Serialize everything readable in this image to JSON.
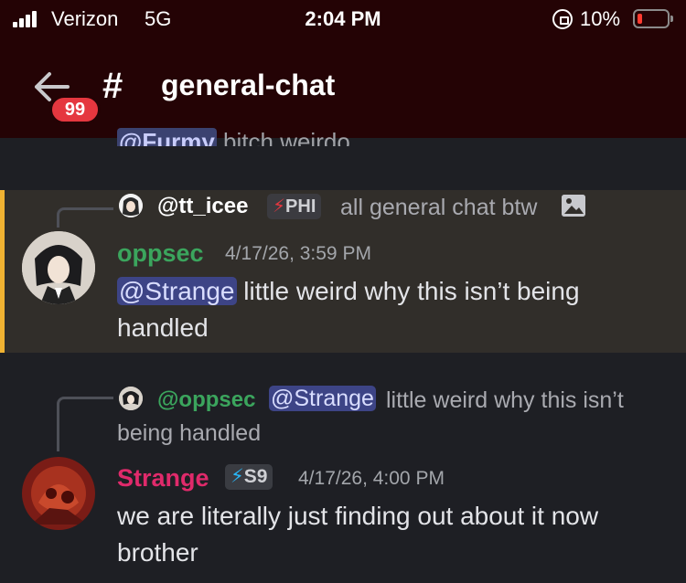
{
  "status_bar": {
    "carrier": "Verizon",
    "network": "5G",
    "time": "2:04 PM",
    "battery": "10%"
  },
  "header": {
    "badge_count": "99",
    "hash": "#",
    "channel": "general-chat"
  },
  "partial_message": {
    "mention": "@Furmy",
    "text": "bitch weirdo"
  },
  "message1": {
    "reply": {
      "name": "@tt_icee",
      "tag": "PHI",
      "text": "all general chat btw"
    },
    "author": "oppsec",
    "time": "4/17/26, 3:59 PM",
    "mention": "@Strange",
    "text_line1": "little weird why this isn’t being",
    "text_line2": "handled",
    "author_color": "#3ba55d",
    "highlight_bar": "#f0b232"
  },
  "message2": {
    "reply": {
      "name": "@oppsec",
      "mention": "@Strange",
      "text_line1": "little weird why this isn’t",
      "text_line2": "being handled"
    },
    "author": "Strange",
    "tag": "S9",
    "time": "4/17/26, 4:00 PM",
    "text_line1": "we are literally just finding out about it now",
    "text_line2": "brother",
    "author_color": "#e02a6b"
  }
}
